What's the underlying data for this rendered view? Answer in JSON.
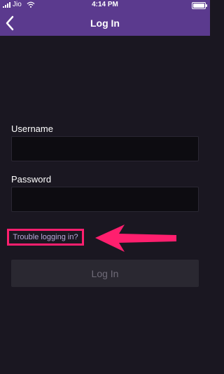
{
  "status_bar": {
    "carrier": "Jio",
    "time": "4:14 PM"
  },
  "header": {
    "title": "Log In",
    "back_icon": "chevron-left-icon",
    "background": "#5b3a8e"
  },
  "form": {
    "username_label": "Username",
    "username_value": "",
    "password_label": "Password",
    "password_value": "",
    "trouble_link": "Trouble logging in?",
    "login_button": "Log In"
  },
  "annotation": {
    "highlight_color": "#ff1f6e",
    "arrow_icon": "arrow-left-icon"
  }
}
